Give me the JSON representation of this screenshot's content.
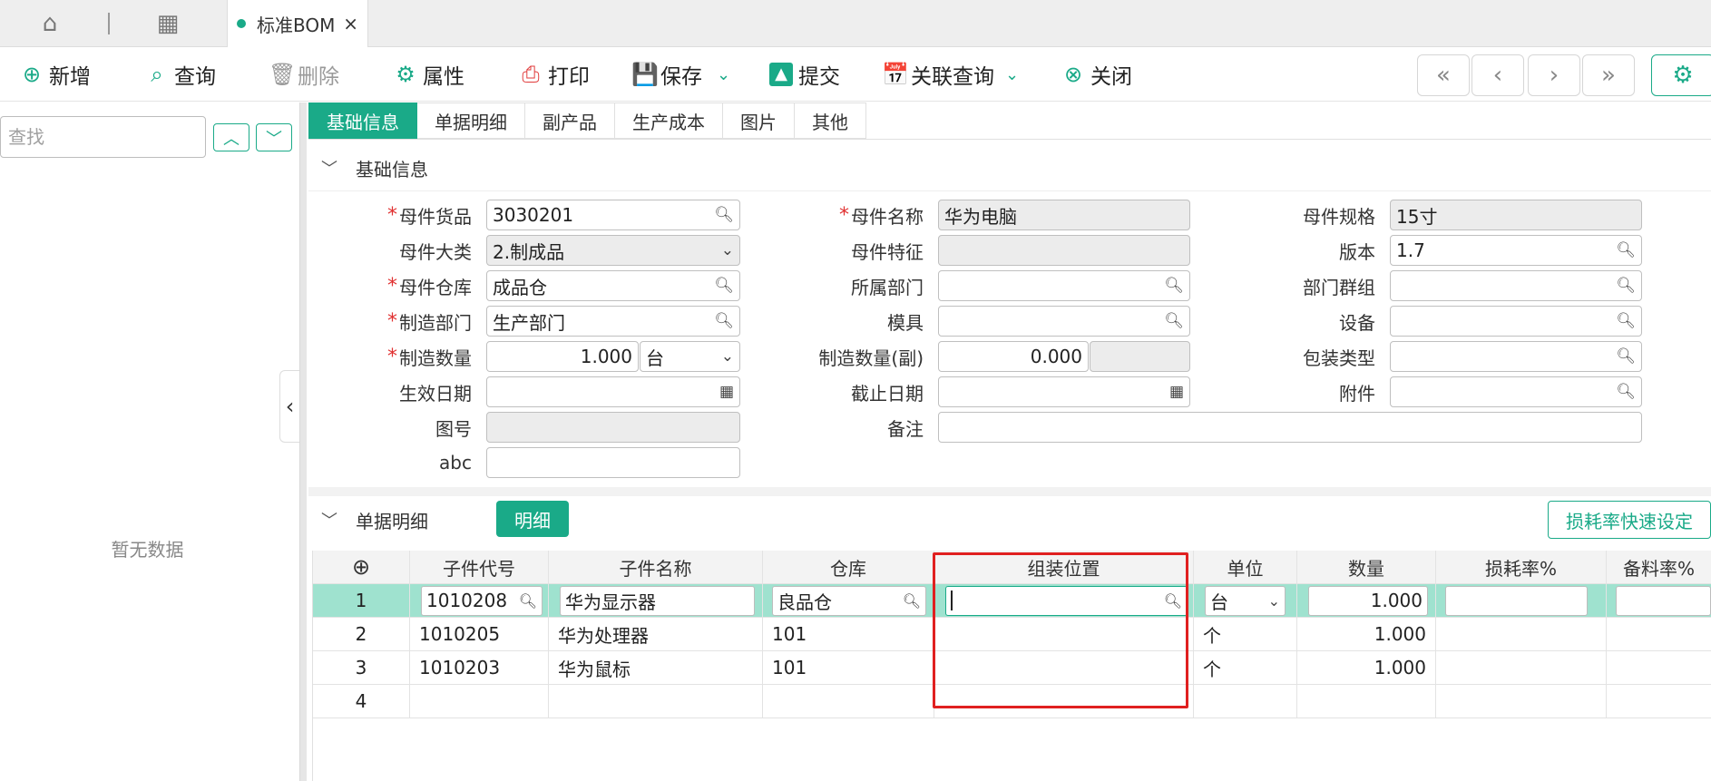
{
  "tabbar": {
    "doc_tab_title": "标准BOM",
    "close_glyph": "×"
  },
  "toolbar": {
    "new": "新增",
    "query": "查询",
    "delete": "删除",
    "properties": "属性",
    "print": "打印",
    "save": "保存",
    "submit": "提交",
    "linked_query": "关联查询",
    "close": "关闭"
  },
  "left": {
    "search_placeholder": "查找",
    "empty": "暂无数据"
  },
  "subtabs": [
    "基础信息",
    "单据明细",
    "副产品",
    "生产成本",
    "图片",
    "其他"
  ],
  "basic": {
    "section_title": "基础信息",
    "fields": {
      "parent_code": {
        "label": "母件货品",
        "value": "3030201"
      },
      "parent_category": {
        "label": "母件大类",
        "value": "2.制成品"
      },
      "parent_warehouse": {
        "label": "母件仓库",
        "value": "成品仓"
      },
      "mfg_dept": {
        "label": "制造部门",
        "value": "生产部门"
      },
      "mfg_qty": {
        "label": "制造数量",
        "value": "1.000",
        "unit": "台"
      },
      "effective_date": {
        "label": "生效日期",
        "value": ""
      },
      "drawing_no": {
        "label": "图号",
        "value": ""
      },
      "abc": {
        "label": "abc",
        "value": ""
      },
      "parent_name": {
        "label": "母件名称",
        "value": "华为电脑"
      },
      "parent_feature": {
        "label": "母件特征",
        "value": ""
      },
      "owning_dept": {
        "label": "所属部门",
        "value": ""
      },
      "mold": {
        "label": "模具",
        "value": ""
      },
      "mfg_qty_sub": {
        "label": "制造数量(副)",
        "value": "0.000"
      },
      "expiry_date": {
        "label": "截止日期",
        "value": ""
      },
      "remark": {
        "label": "备注",
        "value": ""
      },
      "parent_spec": {
        "label": "母件规格",
        "value": "15寸"
      },
      "version": {
        "label": "版本",
        "value": "1.7"
      },
      "dept_group": {
        "label": "部门群组",
        "value": ""
      },
      "equipment": {
        "label": "设备",
        "value": ""
      },
      "package_type": {
        "label": "包装类型",
        "value": ""
      },
      "attachment": {
        "label": "附件",
        "value": ""
      }
    }
  },
  "detail": {
    "section_title": "单据明细",
    "mingxi_button": "明细",
    "loss_button": "损耗率快速设定",
    "columns": [
      "子件代号",
      "子件名称",
      "仓库",
      "组装位置",
      "单位",
      "数量",
      "损耗率%",
      "备料率%"
    ],
    "rows": [
      {
        "no": "1",
        "code": "1010208",
        "name": "华为显示器",
        "warehouse": "良品仓",
        "position": "",
        "unit": "台",
        "qty": "1.000",
        "loss": "",
        "prep": ""
      },
      {
        "no": "2",
        "code": "1010205",
        "name": "华为处理器",
        "warehouse": "101",
        "position": "",
        "unit": "个",
        "qty": "1.000",
        "loss": "",
        "prep": ""
      },
      {
        "no": "3",
        "code": "1010203",
        "name": "华为鼠标",
        "warehouse": "101",
        "position": "",
        "unit": "个",
        "qty": "1.000",
        "loss": "",
        "prep": ""
      },
      {
        "no": "4",
        "code": "",
        "name": "",
        "warehouse": "",
        "position": "",
        "unit": "",
        "qty": "",
        "loss": "",
        "prep": ""
      }
    ]
  },
  "colors": {
    "accent": "#1aaa88",
    "selected_row": "#9fe2cf",
    "required": "#e03030",
    "highlight_box": "#e02020"
  }
}
